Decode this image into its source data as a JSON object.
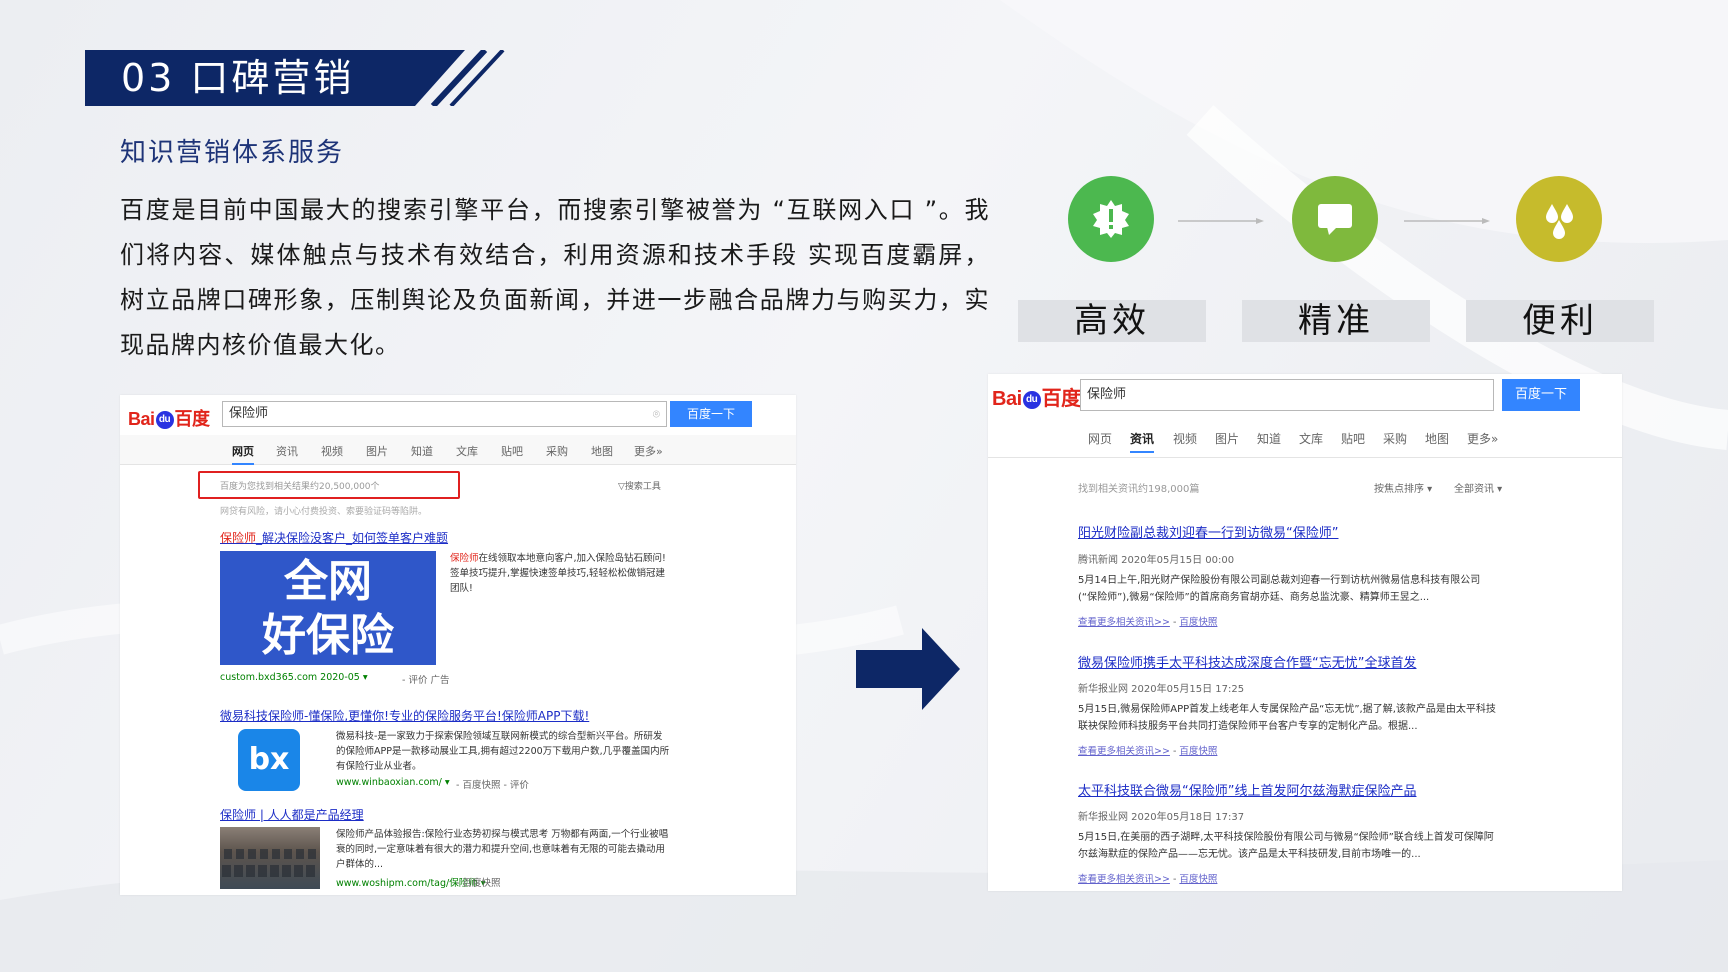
{
  "header": {
    "title": "03 口碑营销",
    "subtitle": "知识营销体系服务"
  },
  "body_text": "百度是目前中国最大的搜索引擎平台，而搜索引擎被誉为 “互联网入口 ”。我们将内容、媒体触点与技术有效结合，利用资源和技术手段 实现百度霸屏，树立品牌口碑形象，压制舆论及负面新闻，并进一步融合品牌力与购买力，实现品牌内核价值最大化。",
  "features": [
    {
      "label": "高效",
      "icon": "alert-badge-icon",
      "color": "#4cb84f"
    },
    {
      "label": "精准",
      "icon": "chat-bubble-icon",
      "color": "#7fb93d"
    },
    {
      "label": "便利",
      "icon": "drops-icon",
      "color": "#c6bb2c"
    }
  ],
  "colors": {
    "navy": "#0d2766",
    "baidu_blue": "#3385ff",
    "baidu_red": "#e1251b"
  },
  "left_shot": {
    "logo": "Bai du 百度",
    "query": "保险师",
    "button": "百度一下",
    "tabs": [
      "网页",
      "资讯",
      "视频",
      "图片",
      "知道",
      "文库",
      "贴吧",
      "采购",
      "地图",
      "更多»"
    ],
    "active_tab": "网页",
    "result_count": "百度为您找到相关结果约20,500,000个",
    "search_tools": "▽搜索工具",
    "warning": "网贷有风险，请小心付费投资、索要验证码等陷阱。",
    "results": [
      {
        "title_prefix": "保险师",
        "title_rest": "_解决保险没客户_如何签单客户难题",
        "ad_image_text": [
          "全网",
          "好保险"
        ],
        "snippet_prefix": "保险师",
        "snippet_rest": "在线领取本地意向客户,加入保险岛钻石顾问!签单技巧提升,掌握快速签单技巧,轻轻松松做销冠建团队!",
        "url": "custom.bxd365.com  2020-05 ▾",
        "links": "- 评价  广告"
      },
      {
        "title": "微易科技保险师-懂保险,更懂你!专业的保险服务平台!保险师APP下载!",
        "logo_text": "bx",
        "snippet": "微易科技-是一家致力于探索保险领域互联网新模式的综合型新兴平台。所研发的保险师APP是一款移动展业工具,拥有超过2200万下载用户数,几乎覆盖国内所有保险行业从业者。",
        "url": "www.winbaoxian.com/ ▾",
        "links": "- 百度快照 - 评价"
      },
      {
        "title": "保险师 | 人人都是产品经理",
        "snippet": "保险师产品体验报告:保险行业态势初探与模式思考 万物都有两面,一个行业被唱衰的同时,一定意味着有很大的潜力和提升空间,也意味着有无限的可能去撬动用户群体的...",
        "url": "www.woshipm.com/tag/保险师 ▾",
        "links": "- 百度快照"
      }
    ]
  },
  "right_shot": {
    "logo": "Bai du 百度",
    "query": "保险师",
    "button": "百度一下",
    "tabs": [
      "网页",
      "资讯",
      "视频",
      "图片",
      "知道",
      "文库",
      "贴吧",
      "采购",
      "地图",
      "更多»"
    ],
    "active_tab": "资讯",
    "result_count": "找到相关资讯约198,000篇",
    "sort": "按焦点排序 ▾",
    "filter": "全部资讯 ▾",
    "news": [
      {
        "title": "阳光财险副总裁刘迎春一行到访微易“保险师”",
        "meta": "腾讯新闻   2020年05月15日 00:00",
        "snippet": "5月14日上午,阳光财产保险股份有限公司副总裁刘迎春一行到访杭州微易信息科技有限公司(“保险师”),微易“保险师”的首席商务官胡亦廷、商务总监沈豪、精算师王昱之...",
        "more": "查看更多相关资讯>>",
        "snapshot": "百度快照"
      },
      {
        "title": "微易保险师携手太平科技达成深度合作暨“忘无忧”全球首发",
        "meta": "新华报业网   2020年05月15日 17:25",
        "snippet": "5月15日,微易保险师APP首发上线老年人专属保险产品“忘无忧”,据了解,该款产品是由太平科技联袂保险师科技服务平台共同打造保险师平台客户专享的定制化产品。根据...",
        "more": "查看更多相关资讯>>",
        "snapshot": "百度快照"
      },
      {
        "title": "太平科技联合微易“保险师”线上首发阿尔兹海默症保险产品",
        "meta": "新华报业网   2020年05月18日 17:37",
        "snippet": "5月15日,在美丽的西子湖畔,太平科技保险股份有限公司与微易“保险师”联合线上首发可保障阿尔兹海默症的保险产品——忘无忧。该产品是太平科技研发,目前市场唯一的...",
        "more": "查看更多相关资讯>>",
        "snapshot": "百度快照"
      }
    ]
  }
}
